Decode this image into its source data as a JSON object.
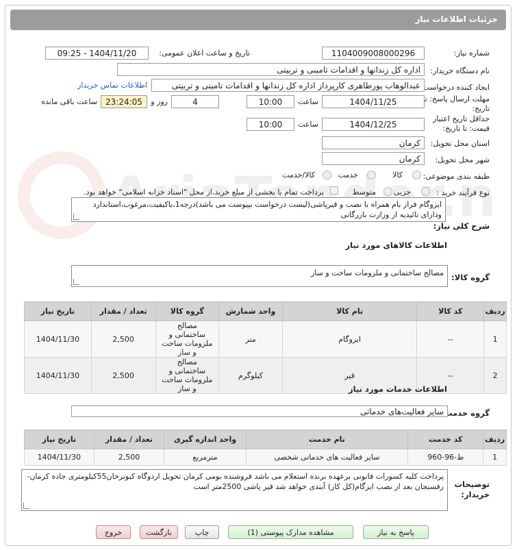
{
  "title": "جزئیات اطلاعات نیاز",
  "fields": {
    "need_number_label": "شماره نیاز:",
    "need_number": "1104009008000296",
    "announce_label": "تاریخ و ساعت اعلان عمومی:",
    "announce_value": "1404/11/20 - 09:25",
    "buyer_org_label": "نام دستگاه خریدار:",
    "buyer_org": "اداره کل زندانها و اقدامات تامینی و تربیتی",
    "requester_label": "ایجاد کننده درخواست:",
    "requester": "عبدالوهاب پورطاهری کارپرداز اداره کل زندانها و اقدامات تامینی و تربیتی",
    "contact_link": "اطلاعات تماس خریدار",
    "send_deadline_label_1": "مهلت ارسال پاسخ: تا",
    "send_deadline_label_2": "تاریخ:",
    "send_date": "1404/11/25",
    "hour_label": "ساعت",
    "send_time": "10:00",
    "days_value": "4",
    "days_label": "روز و",
    "remaining_time": "23:24:05",
    "remaining_label": "ساعت باقی مانده",
    "min_validity_label_1": "حداقل تاریخ اعتبار",
    "min_validity_label_2": "قیمت: تا تاریخ:",
    "validity_date": "1404/12/25",
    "validity_time": "10:00",
    "province_label": "استان محل تحویل:",
    "province": "کرمان",
    "city_label": "شهر محل تحویل:",
    "city": "کرمان",
    "category_label": "طبقه بندی موضوعی:",
    "category_options": [
      "کالا",
      "خدمت",
      "کالا/خدمت"
    ],
    "process_label": "نوع فرآیند خرید :",
    "process_options": [
      "جزیی",
      "متوسط"
    ],
    "payment_note": "پرداخت تمام یا بخشی از مبلغ خرید،از محل \"اسناد خزانه اسلامی\" خواهد بود."
  },
  "need_summary_label": "شرح کلی نیاز:",
  "need_summary": "ایزوگام فراز بام همراه با نصب و قیرپاشی(لیست درخواست بپیوست می باشد)درجه1،باکیفیت،مرغوب،استاندارد ودارای تائیدیه از وزارت بازرگانی",
  "goods_section": "اطلاعات کالاهای مورد نیاز",
  "goods_group_label": "گروه کالا:",
  "goods_group": "مصالح ساختمانی و ملزومات ساخت و ساز",
  "goods_table": {
    "headers": [
      "ردیف",
      "کد کالا",
      "نام کالا",
      "واحد شمارش",
      "گروه کالا",
      "تعداد / مقدار",
      "تاریخ نیاز"
    ],
    "rows": [
      [
        "1",
        "--",
        "ایزوگام",
        "متر",
        "مصالح ساختمانی و ملزومات ساخت و ساز",
        "2,500",
        "1404/11/30"
      ],
      [
        "2",
        "--",
        "قیر",
        "کیلوگرم",
        "مصالح ساختمانی و ملزومات ساخت و ساز",
        "2,500",
        "1404/11/30"
      ]
    ]
  },
  "services_section": "اطلاعات خدمات مورد نیاز",
  "service_group_label": "گروه خدمت:",
  "service_group": "سایر فعالیت‌های خدماتی",
  "services_table": {
    "headers": [
      "ردیف",
      "کد خدمت",
      "نام خدمت",
      "واحد اندازه گیری",
      "تعداد / مقدار",
      "تاریخ نیاز"
    ],
    "rows": [
      [
        "1",
        "ط-96-960",
        "سایر فعالیت های خدماتی شخصی",
        "مترمربع",
        "2,500",
        "1404/11/30"
      ]
    ]
  },
  "buyer_notes_label_1": "توضیحات",
  "buyer_notes_label_2": "خریدار:",
  "buyer_notes": "پرداخت کلیه کسورات قانونی برعهده برنده استعلام می باشد فروشنده بومی کرمان تحویل اردوگاه کبوترخان55کیلومتری جاده کرمان-رفسنجان بعد از نصب ایزگام(کل کار) آبندی خواهد شد قیر پاشی 2500متر است",
  "buttons": {
    "reply": "پاسخ به نیاز",
    "attachments": "مشاهده مدارک پیوستی (1)",
    "print": "چاپ",
    "back": "بازگشت",
    "exit": "خروج"
  },
  "watermark_text": "AriaTender.neT"
}
